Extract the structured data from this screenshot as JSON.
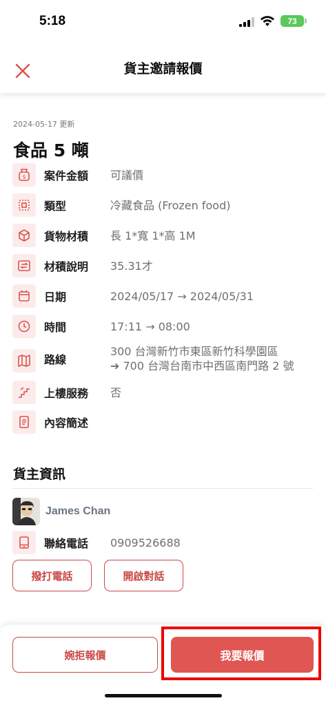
{
  "status_bar": {
    "time": "5:18",
    "battery": "73"
  },
  "header": {
    "title": "貨主邀請報價"
  },
  "updated_text": "2024-05-17 更新",
  "case_title": "食品 5 噸",
  "details": [
    {
      "icon": "money-bag-icon",
      "label": "案件金額",
      "value": "可議價"
    },
    {
      "icon": "grid-dots-icon",
      "label": "類型",
      "value": "冷藏食品 (Frozen food)"
    },
    {
      "icon": "box-icon",
      "label": "貨物材積",
      "value": "長 1*寬 1*高 1M"
    },
    {
      "icon": "swap-arrows-icon",
      "label": "材積說明",
      "value": "35.31才"
    },
    {
      "icon": "calendar-icon",
      "label": "日期",
      "value": "2024/05/17 → 2024/05/31"
    },
    {
      "icon": "clock-icon",
      "label": "時間",
      "value": "17:11 → 08:00"
    },
    {
      "icon": "map-icon",
      "label": "路線",
      "value": "300 台灣新竹市東區新竹科學園區",
      "value2": "➔ 700 台灣台南市中西區南門路 2 號"
    },
    {
      "icon": "stairs-icon",
      "label": "上樓服務",
      "value": "否"
    },
    {
      "icon": "document-icon",
      "label": "內容簡述",
      "value": ""
    }
  ],
  "owner_section": {
    "title": "貨主資訊",
    "name": "James Chan",
    "phone_label": "聯絡電話",
    "phone": "0909526688",
    "call_button": "撥打電話",
    "chat_button": "開啟對話"
  },
  "actions": {
    "decline": "婉拒報價",
    "quote": "我要報價"
  },
  "colors": {
    "accent": "#e05652",
    "accent_outline": "#c94845",
    "icon_bg": "#fbeceb",
    "highlight": "#ee0000"
  }
}
